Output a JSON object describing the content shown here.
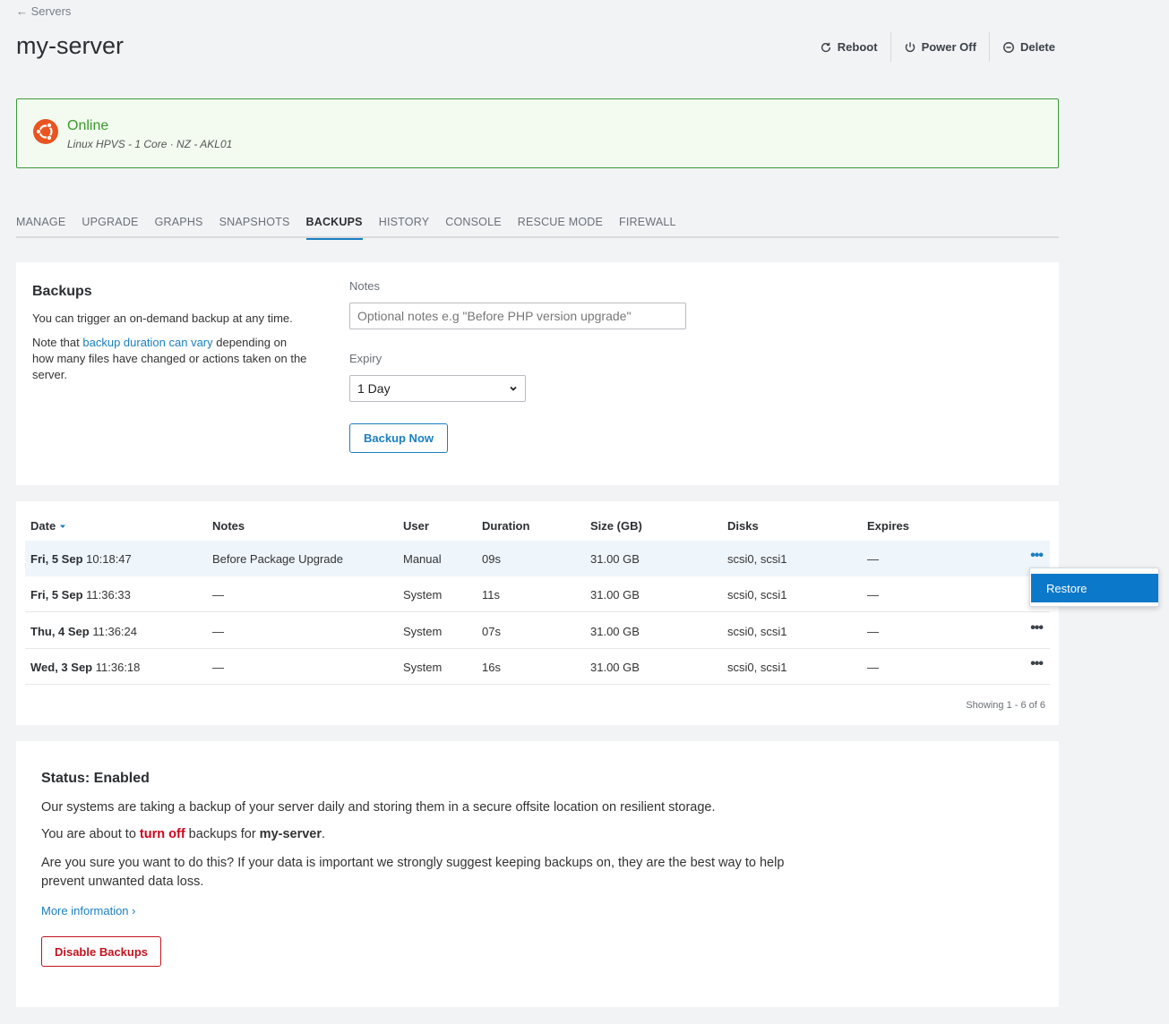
{
  "breadcrumb": {
    "back_label": "← Servers"
  },
  "header": {
    "title": "my-server",
    "actions": [
      {
        "label": "Reboot",
        "icon": "refresh-icon"
      },
      {
        "label": "Power Off",
        "icon": "power-icon"
      },
      {
        "label": "Delete",
        "icon": "minus-circle-icon"
      }
    ]
  },
  "status": {
    "state": "Online",
    "details": "Linux HPVS - 1 Core · NZ - AKL01",
    "os_icon": "ubuntu-logo",
    "color": "#3a9a2a"
  },
  "tabs": [
    "MANAGE",
    "UPGRADE",
    "GRAPHS",
    "SNAPSHOTS",
    "BACKUPS",
    "HISTORY",
    "CONSOLE",
    "RESCUE MODE",
    "FIREWALL"
  ],
  "active_tab": "BACKUPS",
  "backup_form": {
    "heading": "Backups",
    "desc1": "You can trigger an on-demand backup at any time.",
    "desc2_prefix": "Note that ",
    "desc2_link": "backup duration can vary",
    "desc2_suffix": " depending on how many files have changed or actions taken on the server.",
    "notes_label": "Notes",
    "notes_placeholder": "Optional notes e.g \"Before PHP version upgrade\"",
    "notes_value": "",
    "expiry_label": "Expiry",
    "expiry_value": "1 Day",
    "submit_label": "Backup Now"
  },
  "table": {
    "columns": [
      "Date",
      "Notes",
      "User",
      "Duration",
      "Size (GB)",
      "Disks",
      "Expires"
    ],
    "rows": [
      {
        "date_bold": "Fri, 5 Sep",
        "time": "10:18:47",
        "notes": "Before Package Upgrade",
        "user": "Manual",
        "duration": "09s",
        "size": "31.00 GB",
        "disks": "scsi0, scsi1",
        "expires": "—"
      },
      {
        "date_bold": "Fri, 5 Sep",
        "time": "11:36:33",
        "notes": "—",
        "user": "System",
        "duration": "11s",
        "size": "31.00 GB",
        "disks": "scsi0, scsi1",
        "expires": "—"
      },
      {
        "date_bold": "Thu, 4 Sep",
        "time": "11:36:24",
        "notes": "—",
        "user": "System",
        "duration": "07s",
        "size": "31.00 GB",
        "disks": "scsi0, scsi1",
        "expires": "—"
      },
      {
        "date_bold": "Wed, 3 Sep",
        "time": "11:36:18",
        "notes": "—",
        "user": "System",
        "duration": "16s",
        "size": "31.00 GB",
        "disks": "scsi0, scsi1",
        "expires": "—"
      }
    ],
    "more_icon": "•••",
    "showing": "Showing 1 - 6 of 6"
  },
  "row_menu": {
    "items": [
      "Restore"
    ]
  },
  "backup_status": {
    "heading": "Status: Enabled",
    "para1": "Our systems are taking a backup of your server daily and storing them in a secure offsite location on resilient storage.",
    "para2_prefix": "You are about to ",
    "para2_highlight": "turn off",
    "para2_middle": " backups for ",
    "para2_server": "my-server",
    "para2_suffix": ".",
    "para3": "Are you sure you want to do this? If your data is important we strongly suggest keeping backups on, they are the best way to help prevent unwanted data loss.",
    "more_info": "More information ›",
    "disable_label": "Disable Backups"
  }
}
